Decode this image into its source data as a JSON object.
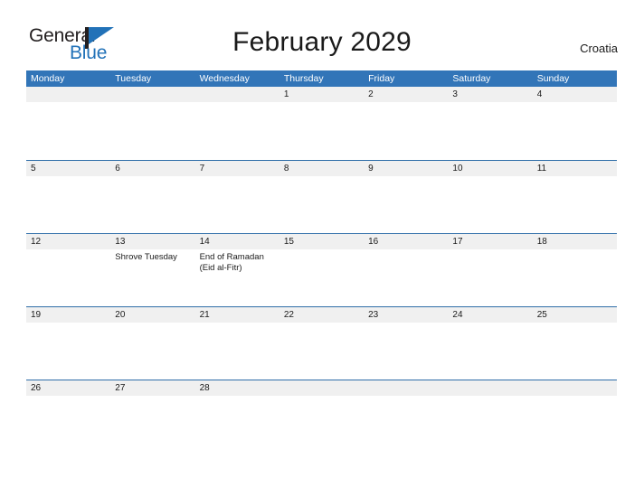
{
  "brand": {
    "name_part1": "General",
    "name_part2": "Blue",
    "flag_icon": "flag-triangle-icon",
    "accent_color": "#2272b8"
  },
  "header": {
    "title": "February 2029",
    "country": "Croatia"
  },
  "calendar": {
    "month": "February",
    "year": "2029",
    "header_color": "#3275b8",
    "band_color": "#f0f0f0",
    "border_color": "#2e6da8",
    "weekdays": [
      "Monday",
      "Tuesday",
      "Wednesday",
      "Thursday",
      "Friday",
      "Saturday",
      "Sunday"
    ],
    "weeks": [
      [
        {
          "day": ""
        },
        {
          "day": ""
        },
        {
          "day": ""
        },
        {
          "day": "1"
        },
        {
          "day": "2"
        },
        {
          "day": "3"
        },
        {
          "day": "4"
        }
      ],
      [
        {
          "day": "5"
        },
        {
          "day": "6"
        },
        {
          "day": "7"
        },
        {
          "day": "8"
        },
        {
          "day": "9"
        },
        {
          "day": "10"
        },
        {
          "day": "11"
        }
      ],
      [
        {
          "day": "12"
        },
        {
          "day": "13",
          "events": [
            "Shrove Tuesday"
          ]
        },
        {
          "day": "14",
          "events": [
            "End of Ramadan",
            "(Eid al-Fitr)"
          ]
        },
        {
          "day": "15"
        },
        {
          "day": "16"
        },
        {
          "day": "17"
        },
        {
          "day": "18"
        }
      ],
      [
        {
          "day": "19"
        },
        {
          "day": "20"
        },
        {
          "day": "21"
        },
        {
          "day": "22"
        },
        {
          "day": "23"
        },
        {
          "day": "24"
        },
        {
          "day": "25"
        }
      ],
      [
        {
          "day": "26"
        },
        {
          "day": "27"
        },
        {
          "day": "28"
        },
        {
          "day": ""
        },
        {
          "day": ""
        },
        {
          "day": ""
        },
        {
          "day": ""
        }
      ]
    ]
  }
}
